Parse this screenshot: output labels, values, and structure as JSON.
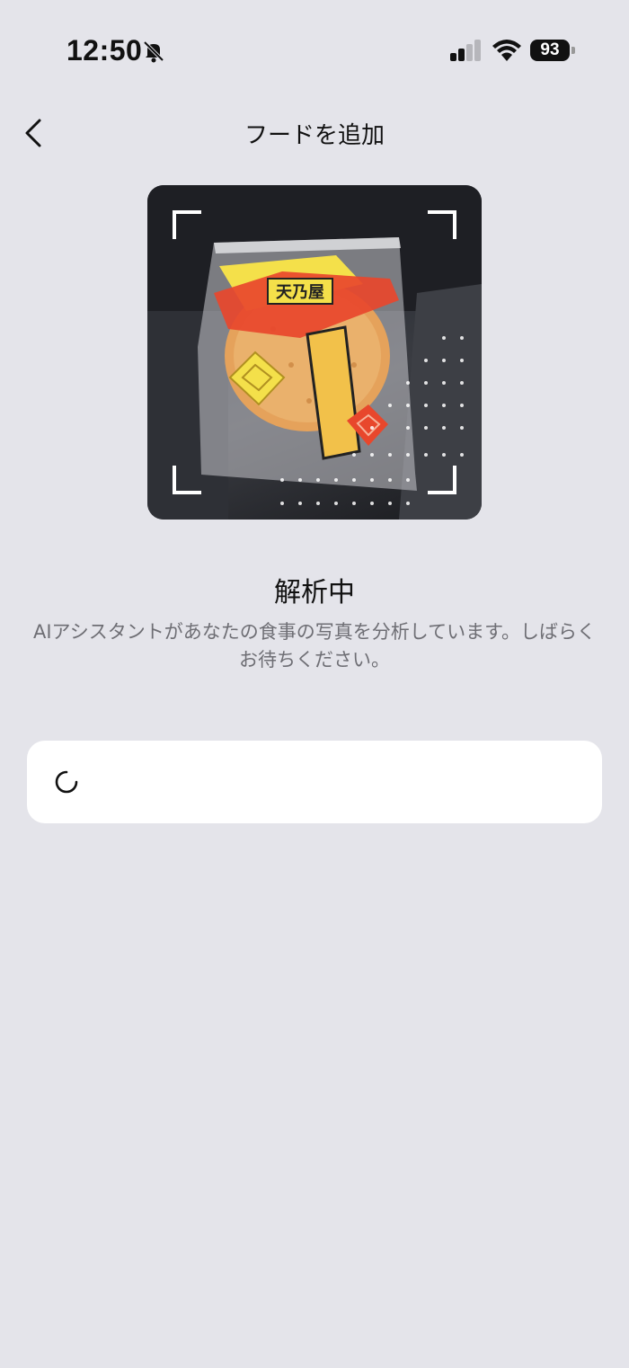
{
  "status_bar": {
    "time": "12:50",
    "battery_level": "93",
    "icons": [
      "bell-slash-icon",
      "cellular-signal-icon",
      "wifi-icon",
      "battery-icon"
    ]
  },
  "nav": {
    "back_icon": "chevron-left-icon",
    "title": "フードを追加"
  },
  "photo": {
    "description_icon": "food-photo",
    "packaging_text": "天乃屋"
  },
  "analysis": {
    "title": "解析中",
    "description": "AIアシスタントがあなたの食事の写真を分析しています。しばらくお待ちください。"
  },
  "loading_card": {
    "icon": "loading-spinner-icon"
  },
  "colors": {
    "background": "#e4e4ea",
    "card": "#ffffff",
    "secondary_text": "#6e6e74"
  }
}
